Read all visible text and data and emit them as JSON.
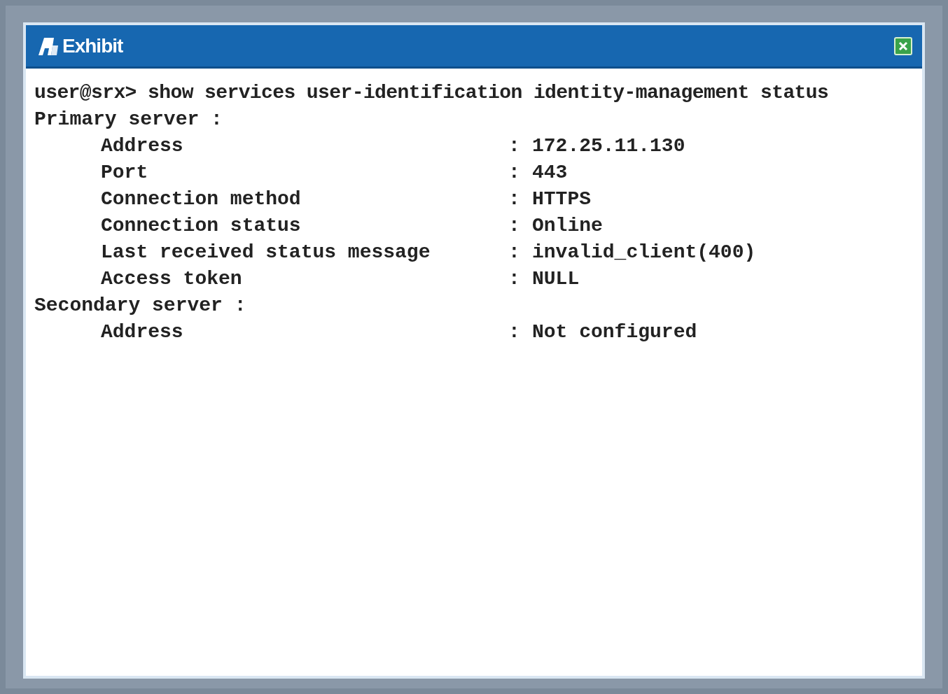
{
  "window": {
    "title": "Exhibit"
  },
  "terminal": {
    "command": "user@srx> show services user-identification identity-management status",
    "sections": [
      {
        "heading": "Primary server :",
        "fields": [
          {
            "label": "Address",
            "separator": ":",
            "value": "172.25.11.130"
          },
          {
            "label": "Port",
            "separator": ":",
            "value": "443"
          },
          {
            "label": "Connection method",
            "separator": ":",
            "value": "HTTPS"
          },
          {
            "label": "Connection status",
            "separator": ":",
            "value": "Online"
          },
          {
            "label": "Last received status message",
            "separator": ":",
            "value": "invalid_client(400)"
          },
          {
            "label": "Access token",
            "separator": ":",
            "value": "NULL"
          }
        ]
      },
      {
        "heading": "Secondary server :",
        "fields": [
          {
            "label": "Address",
            "separator": ":",
            "value": "Not configured"
          }
        ]
      }
    ]
  }
}
